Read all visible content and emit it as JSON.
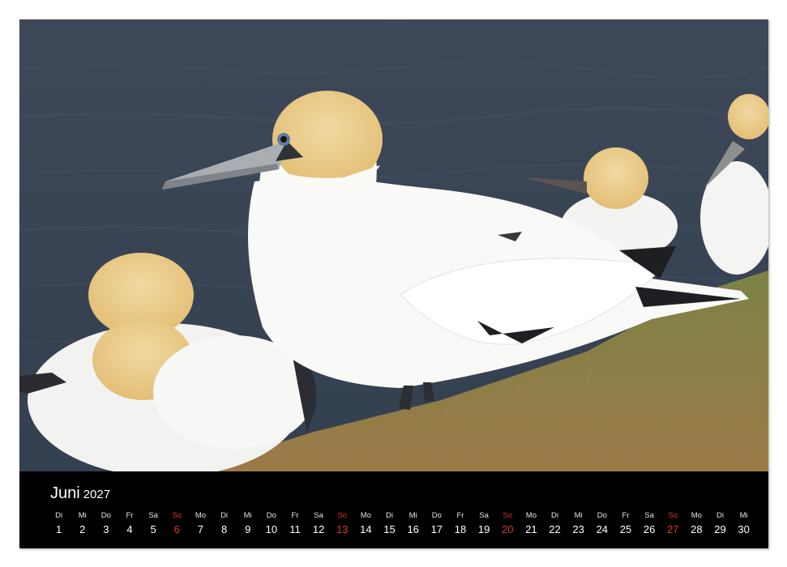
{
  "calendar": {
    "month": "Juni",
    "year": "2027",
    "accent_color": "#e0352c",
    "days": [
      {
        "wd": "Di",
        "num": "1",
        "sunday": false
      },
      {
        "wd": "Mi",
        "num": "2",
        "sunday": false
      },
      {
        "wd": "Do",
        "num": "3",
        "sunday": false
      },
      {
        "wd": "Fr",
        "num": "4",
        "sunday": false
      },
      {
        "wd": "Sa",
        "num": "5",
        "sunday": false
      },
      {
        "wd": "So",
        "num": "6",
        "sunday": true
      },
      {
        "wd": "Mo",
        "num": "7",
        "sunday": false
      },
      {
        "wd": "Di",
        "num": "8",
        "sunday": false
      },
      {
        "wd": "Mi",
        "num": "9",
        "sunday": false
      },
      {
        "wd": "Do",
        "num": "10",
        "sunday": false
      },
      {
        "wd": "Fr",
        "num": "11",
        "sunday": false
      },
      {
        "wd": "Sa",
        "num": "12",
        "sunday": false
      },
      {
        "wd": "So",
        "num": "13",
        "sunday": true
      },
      {
        "wd": "Mo",
        "num": "14",
        "sunday": false
      },
      {
        "wd": "Di",
        "num": "15",
        "sunday": false
      },
      {
        "wd": "Mi",
        "num": "16",
        "sunday": false
      },
      {
        "wd": "Do",
        "num": "17",
        "sunday": false
      },
      {
        "wd": "Fr",
        "num": "18",
        "sunday": false
      },
      {
        "wd": "Sa",
        "num": "19",
        "sunday": false
      },
      {
        "wd": "So",
        "num": "20",
        "sunday": true
      },
      {
        "wd": "Mo",
        "num": "21",
        "sunday": false
      },
      {
        "wd": "Di",
        "num": "22",
        "sunday": false
      },
      {
        "wd": "Mi",
        "num": "23",
        "sunday": false
      },
      {
        "wd": "Do",
        "num": "24",
        "sunday": false
      },
      {
        "wd": "Fr",
        "num": "25",
        "sunday": false
      },
      {
        "wd": "Sa",
        "num": "26",
        "sunday": false
      },
      {
        "wd": "So",
        "num": "27",
        "sunday": true
      },
      {
        "wd": "Mo",
        "num": "28",
        "sunday": false
      },
      {
        "wd": "Di",
        "num": "29",
        "sunday": false
      },
      {
        "wd": "Mi",
        "num": "30",
        "sunday": false
      }
    ]
  }
}
